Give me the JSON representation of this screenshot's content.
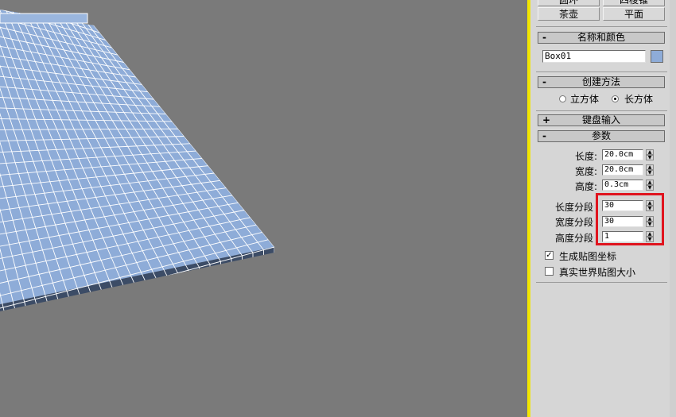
{
  "toolbar": {
    "top_buttons": [
      "圆环",
      "四棱锥"
    ],
    "teapot_label": "茶壶",
    "plane_label": "平面"
  },
  "name_color": {
    "title": "名称和颜色",
    "sign": "-",
    "object_name": "Box01",
    "color": "#8eacd8"
  },
  "creation_method": {
    "title": "创建方法",
    "sign": "-",
    "option_cube": "立方体",
    "option_box": "长方体",
    "selected": "长方体"
  },
  "keyboard_entry": {
    "title": "键盘输入",
    "sign": "+"
  },
  "params": {
    "title": "参数",
    "sign": "-",
    "length_label": "长度:",
    "length_value": "20.0cm",
    "width_label": "宽度:",
    "width_value": "20.0cm",
    "height_label": "高度:",
    "height_value": "0.3cm",
    "length_segs_label": "长度分段",
    "length_segs_value": "30",
    "width_segs_label": "宽度分段",
    "width_segs_value": "30",
    "height_segs_label": "高度分段",
    "height_segs_value": "1",
    "gen_map_coords_label": "生成贴图坐标",
    "gen_map_coords_checked": true,
    "real_world_label": "真实世界贴图大小",
    "real_world_checked": false
  },
  "colors": {
    "viewport_bg": "#7a7a7a",
    "mesh_fill": "#8eacd8",
    "mesh_edge": "#3c4c66",
    "active_border": "#f2e600",
    "highlight": "#e0141e"
  }
}
